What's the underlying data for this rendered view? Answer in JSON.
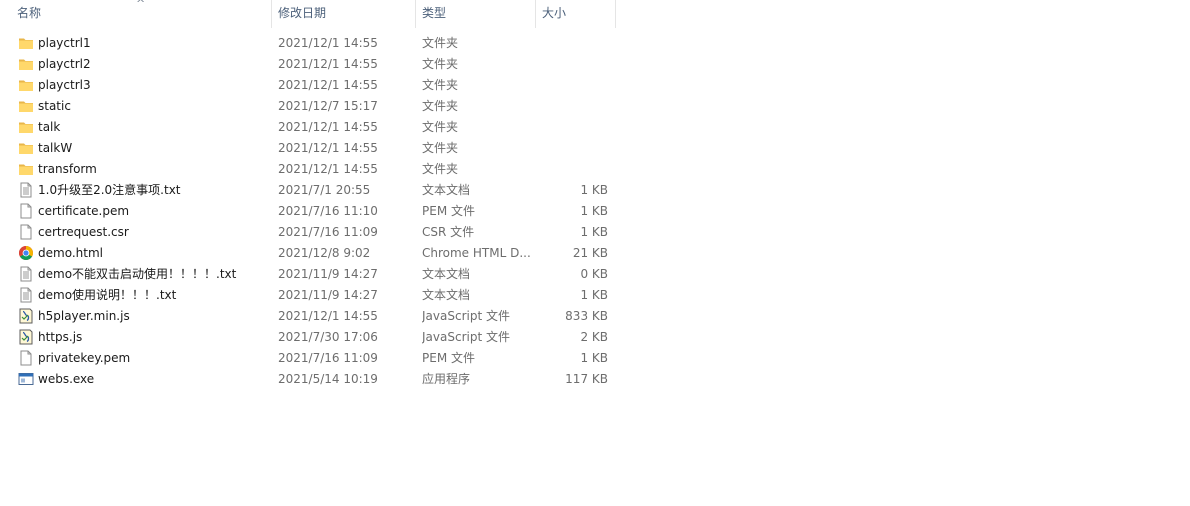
{
  "columns": {
    "name": "名称",
    "date": "修改日期",
    "type": "类型",
    "size": "大小"
  },
  "files": [
    {
      "name": "playctrl1",
      "date": "2021/12/1 14:55",
      "type": "文件夹",
      "size": "",
      "icon": "folder-icon"
    },
    {
      "name": "playctrl2",
      "date": "2021/12/1 14:55",
      "type": "文件夹",
      "size": "",
      "icon": "folder-icon"
    },
    {
      "name": "playctrl3",
      "date": "2021/12/1 14:55",
      "type": "文件夹",
      "size": "",
      "icon": "folder-icon"
    },
    {
      "name": "static",
      "date": "2021/12/7 15:17",
      "type": "文件夹",
      "size": "",
      "icon": "folder-icon"
    },
    {
      "name": "talk",
      "date": "2021/12/1 14:55",
      "type": "文件夹",
      "size": "",
      "icon": "folder-icon"
    },
    {
      "name": "talkW",
      "date": "2021/12/1 14:55",
      "type": "文件夹",
      "size": "",
      "icon": "folder-icon"
    },
    {
      "name": "transform",
      "date": "2021/12/1 14:55",
      "type": "文件夹",
      "size": "",
      "icon": "folder-icon"
    },
    {
      "name": "1.0升级至2.0注意事项.txt",
      "date": "2021/7/1 20:55",
      "type": "文本文档",
      "size": "1 KB",
      "icon": "text-file-icon"
    },
    {
      "name": "certificate.pem",
      "date": "2021/7/16 11:10",
      "type": "PEM 文件",
      "size": "1 KB",
      "icon": "blank-file-icon"
    },
    {
      "name": "certrequest.csr",
      "date": "2021/7/16 11:09",
      "type": "CSR 文件",
      "size": "1 KB",
      "icon": "blank-file-icon"
    },
    {
      "name": "demo.html",
      "date": "2021/12/8 9:02",
      "type": "Chrome HTML D...",
      "size": "21 KB",
      "icon": "chrome-icon"
    },
    {
      "name": "demo不能双击启动使用！！！！.txt",
      "date": "2021/11/9 14:27",
      "type": "文本文档",
      "size": "0 KB",
      "icon": "text-file-icon"
    },
    {
      "name": "demo使用说明！！！.txt",
      "date": "2021/11/9 14:27",
      "type": "文本文档",
      "size": "1 KB",
      "icon": "text-file-icon"
    },
    {
      "name": "h5player.min.js",
      "date": "2021/12/1 14:55",
      "type": "JavaScript 文件",
      "size": "833 KB",
      "icon": "script-file-icon"
    },
    {
      "name": "https.js",
      "date": "2021/7/30 17:06",
      "type": "JavaScript 文件",
      "size": "2 KB",
      "icon": "script-file-icon"
    },
    {
      "name": "privatekey.pem",
      "date": "2021/7/16 11:09",
      "type": "PEM 文件",
      "size": "1 KB",
      "icon": "blank-file-icon"
    },
    {
      "name": "webs.exe",
      "date": "2021/5/14 10:19",
      "type": "应用程序",
      "size": "117 KB",
      "icon": "application-icon"
    }
  ]
}
